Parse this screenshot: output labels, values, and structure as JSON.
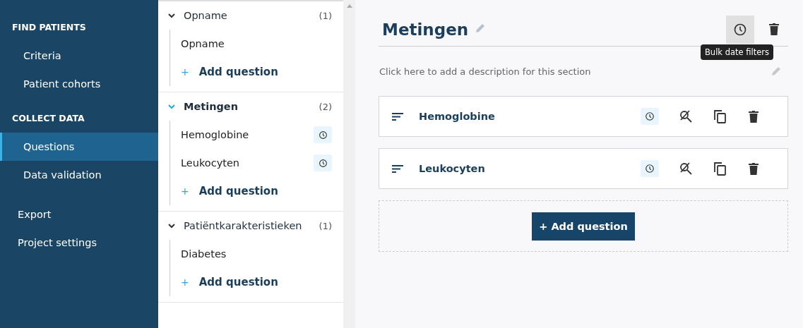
{
  "nav": {
    "groups": [
      {
        "heading": "FIND PATIENTS",
        "items": [
          {
            "label": "Criteria",
            "selected": false
          },
          {
            "label": "Patient cohorts",
            "selected": false
          }
        ]
      },
      {
        "heading": "COLLECT DATA",
        "items": [
          {
            "label": "Questions",
            "selected": true
          },
          {
            "label": "Data validation",
            "selected": false
          }
        ]
      }
    ],
    "extra_items": [
      {
        "label": "Export",
        "selected": false
      },
      {
        "label": "Project settings",
        "selected": false
      }
    ]
  },
  "sections": [
    {
      "title": "Opname",
      "count": "(1)",
      "selected": false,
      "questions": [
        {
          "label": "Opname",
          "date_filter": false
        }
      ],
      "add_label": "Add question",
      "add_icon": "+"
    },
    {
      "title": "Metingen",
      "count": "(2)",
      "selected": true,
      "questions": [
        {
          "label": "Hemoglobine",
          "date_filter": true
        },
        {
          "label": "Leukocyten",
          "date_filter": true
        }
      ],
      "add_label": "Add question",
      "add_icon": "+"
    },
    {
      "title": "Patiëntkarakteristieken",
      "count": "(1)",
      "selected": false,
      "questions": [
        {
          "label": "Diabetes",
          "date_filter": false
        }
      ],
      "add_label": "Add question",
      "add_icon": "+"
    }
  ],
  "detail": {
    "title": "Metingen",
    "tooltip": "Bulk date filters",
    "description": "Click here to add a description for this section",
    "questions": [
      {
        "label": "Hemoglobine",
        "date_filter": true
      },
      {
        "label": "Leukocyten",
        "date_filter": true
      }
    ],
    "add_button": "+ Add question"
  }
}
